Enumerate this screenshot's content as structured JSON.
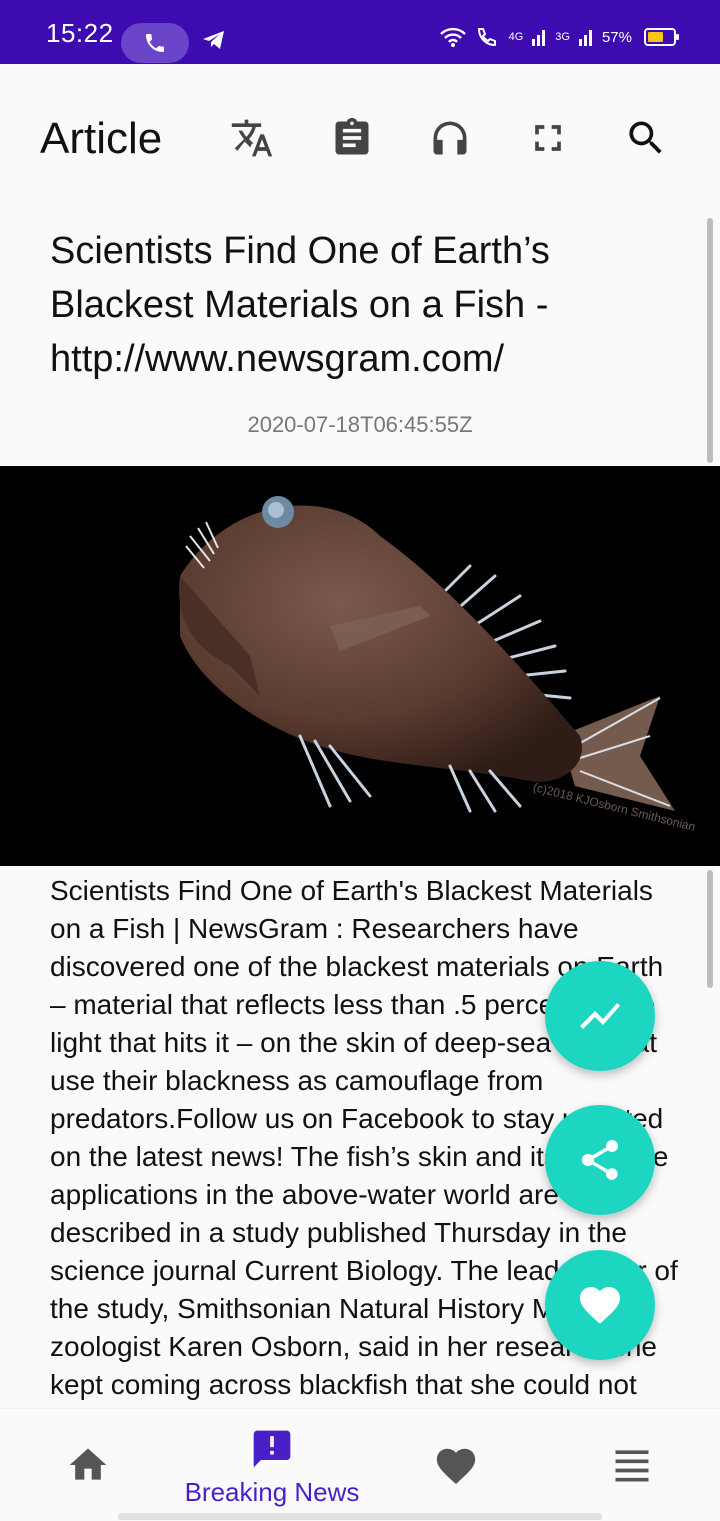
{
  "status_bar": {
    "time": "15:22",
    "battery": "57%",
    "net_4g": "4G",
    "net_3g": "3G"
  },
  "app_bar": {
    "title": "Article",
    "icons": [
      "translate-icon",
      "clipboard-icon",
      "headphones-icon",
      "fullscreen-icon",
      "search-icon"
    ]
  },
  "article": {
    "title": "Scientists Find One of Earth’s Blackest Materials on a Fish - http://www.newsgram.com/",
    "date": "2020-07-18T06:45:55Z",
    "image_credit": "(c)2018 KJOsborn Smithsonian",
    "body": "Scientists Find One of Earth's Blackest Materials on a Fish | NewsGram : Researchers have discovered one of the blackest materials on Earth – material that reflects less than .5 percent of the light that hits it – on the skin of deep-sea fish that use their blackness as camouflage from predators.Follow us on Facebook to stay updated on the latest news! The fish’s skin and its possible applications in the above-water world are described in a study published Thursday in the science journal Current Biology. The lead author of the study, Smithsonian Natural History Museum zoologist Karen Osborn, said in her research she kept coming across blackfish that she could not quite photograph"
  },
  "fabs": [
    "trending-icon",
    "share-icon",
    "heart-icon"
  ],
  "bottom_nav": {
    "items": [
      {
        "icon": "home-icon",
        "label": ""
      },
      {
        "icon": "breaking-news-icon",
        "label": "Breaking News"
      },
      {
        "icon": "favorites-icon",
        "label": ""
      },
      {
        "icon": "menu-icon",
        "label": ""
      }
    ],
    "active_index": 1
  },
  "colors": {
    "status_bar": "#3d0bb0",
    "accent": "#4a1fc8",
    "fab": "#1cd6c2"
  }
}
